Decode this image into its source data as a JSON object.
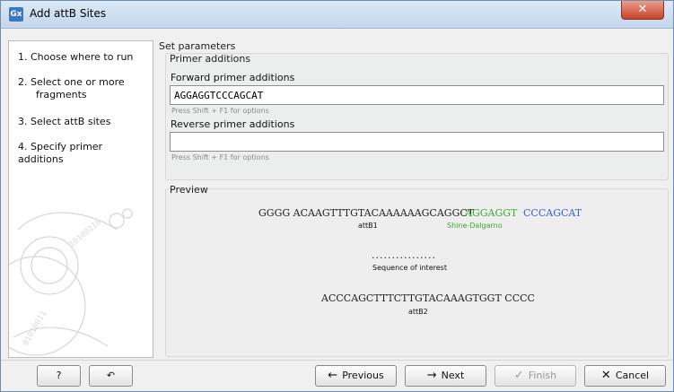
{
  "window": {
    "title": "Add attB Sites",
    "app_icon_text": "Gx"
  },
  "steps": [
    {
      "text": "1.  Choose where to run"
    },
    {
      "text": "2.  Select one or more"
    },
    {
      "text": "fragments"
    },
    {
      "text": "3.  Select attB sites"
    },
    {
      "text": "4.  Specify primer additions"
    }
  ],
  "main": {
    "section_title": "Set parameters",
    "primer_additions": {
      "group_label": "Primer additions",
      "forward_label": "Forward primer additions",
      "forward_value": "AGGAGGTCCCAGCAT",
      "forward_hint": "Press Shift + F1 for options",
      "reverse_label": "Reverse primer additions",
      "reverse_value": "",
      "reverse_hint": "Press Shift + F1 for options"
    },
    "preview": {
      "label": "Preview",
      "top_seq_prefix": "GGGG ACAAGTTTGTACAAAAAAGCAGGCT",
      "top_seq_sd": "AGGAGGT",
      "top_seq_rest": "CCCAGCAT",
      "attB1": "attB1",
      "sd_label": "Shine-Dalgarno",
      "dots": "................",
      "interest_label": "Sequence of interest",
      "bottom_seq": "ACCCAGCTTTCTTGTACAAAGTGGT CCCC",
      "attB2": "attB2",
      "colors": {
        "sd": "#3aa832",
        "rest": "#3b5fd0"
      }
    }
  },
  "buttons": {
    "help": "?",
    "reset_icon": "reset-arrow-icon",
    "previous": "Previous",
    "next": "Next",
    "finish": "Finish",
    "cancel": "Cancel"
  }
}
